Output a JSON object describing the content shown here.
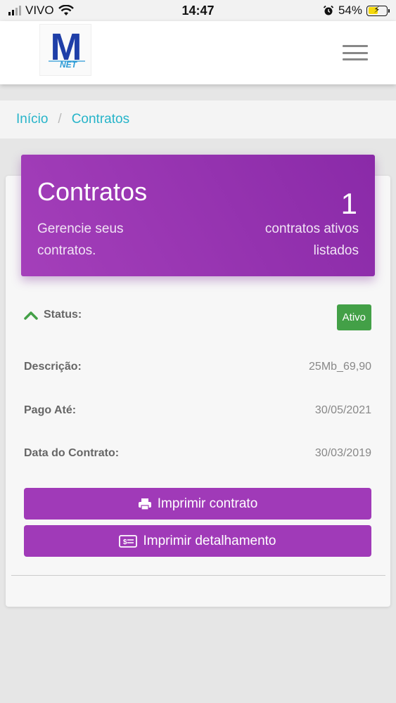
{
  "status_bar": {
    "carrier": "VIVO",
    "time": "14:47",
    "battery_percent": "54%",
    "battery_level": 0.54
  },
  "header": {
    "logo_text": "M",
    "logo_subtext": "NET"
  },
  "breadcrumb": {
    "items": [
      "Início",
      "Contratos"
    ],
    "separator": "/"
  },
  "hero": {
    "title": "Contratos",
    "subtitle": "Gerencie seus contratos.",
    "count": "1",
    "count_label": "contratos ativos listados"
  },
  "contract": {
    "status_label": "Status:",
    "status_value": "Ativo",
    "description_label": "Descrição:",
    "description_value": "25Mb_69,90",
    "paid_until_label": "Pago Até:",
    "paid_until_value": "30/05/2021",
    "contract_date_label": "Data do Contrato:",
    "contract_date_value": "30/03/2019"
  },
  "actions": {
    "print_contract": "Imprimir contrato",
    "print_details": "Imprimir detalhamento"
  },
  "colors": {
    "accent": "#a03ab8",
    "link": "#26b4c9",
    "status_active": "#43a047"
  }
}
